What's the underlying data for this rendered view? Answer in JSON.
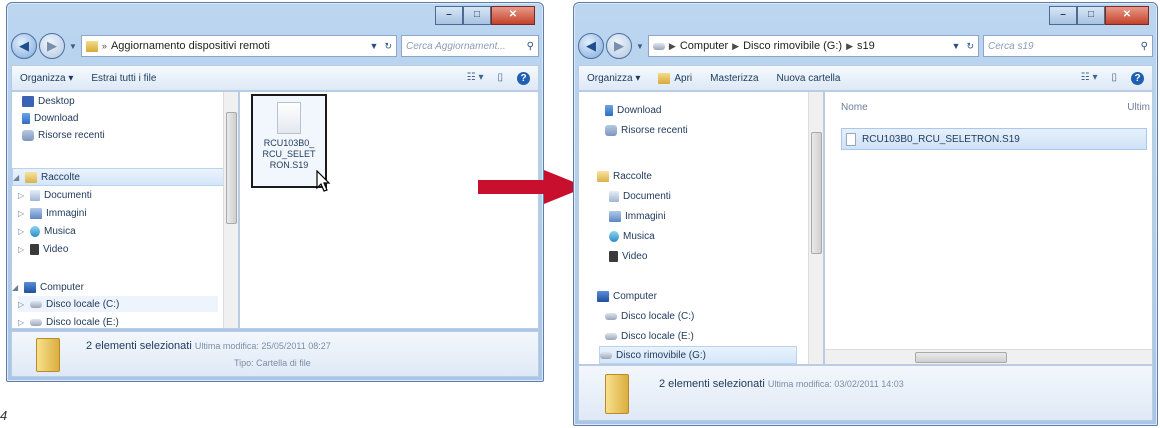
{
  "left_window": {
    "address": {
      "path": [
        "Aggiornamento dispositivi remoti"
      ]
    },
    "search_placeholder": "Cerca Aggiornament...",
    "toolbar": {
      "organize": "Organizza ▾",
      "extract": "Estrai tutti i file"
    },
    "nav_items": [
      {
        "label": "Desktop",
        "icon": "desktop-icon"
      },
      {
        "label": "Download",
        "icon": "download-icon"
      },
      {
        "label": "Risorse recenti",
        "icon": "recent-places-icon"
      },
      {
        "label": "Raccolte",
        "icon": "libraries-icon",
        "selected": true
      },
      {
        "label": "Documenti",
        "icon": "documents-icon"
      },
      {
        "label": "Immagini",
        "icon": "pictures-icon"
      },
      {
        "label": "Musica",
        "icon": "music-icon"
      },
      {
        "label": "Video",
        "icon": "video-icon"
      },
      {
        "label": "Computer",
        "icon": "computer-icon"
      },
      {
        "label": "Disco locale (C:)",
        "icon": "drive-icon"
      },
      {
        "label": "Disco locale (E:)",
        "icon": "drive-icon"
      }
    ],
    "file": {
      "name_lines": [
        "RCU103B0_",
        "RCU_SELET",
        "RON.S19"
      ]
    },
    "status": {
      "text": "2 elementi selezionati",
      "modified_label": "Ultima modifica: 25/05/2011 08:27",
      "type_label": "Tipo: Cartella di file"
    }
  },
  "right_window": {
    "address": {
      "path": [
        "Computer",
        "Disco rimovibile (G:)",
        "s19"
      ]
    },
    "search_placeholder": "Cerca s19",
    "toolbar": {
      "organize": "Organizza ▾",
      "open": "Apri",
      "burn": "Masterizza",
      "new_folder": "Nuova cartella"
    },
    "nav_items": [
      {
        "label": "Download",
        "icon": "download-icon"
      },
      {
        "label": "Risorse recenti",
        "icon": "recent-places-icon"
      },
      {
        "label": "Raccolte",
        "icon": "libraries-icon"
      },
      {
        "label": "Documenti",
        "icon": "documents-icon"
      },
      {
        "label": "Immagini",
        "icon": "pictures-icon"
      },
      {
        "label": "Musica",
        "icon": "music-icon"
      },
      {
        "label": "Video",
        "icon": "video-icon"
      },
      {
        "label": "Computer",
        "icon": "computer-icon"
      },
      {
        "label": "Disco locale (C:)",
        "icon": "drive-icon"
      },
      {
        "label": "Disco locale (E:)",
        "icon": "drive-icon"
      },
      {
        "label": "Disco rimovibile (G:)",
        "icon": "removable-drive-icon",
        "selected": true
      }
    ],
    "columns": {
      "name": "Nome",
      "modified": "Ultim"
    },
    "file": {
      "name": "RCU103B0_RCU_SELETRON.S19"
    },
    "status": {
      "text": "2 elementi selezionati",
      "modified_label": "Ultima modifica: 03/02/2011 14:03"
    }
  },
  "figure_number": "4",
  "colors": {
    "arrow": "#c8102e",
    "selection": "#d4e6f9",
    "frame": "#a9c6e6"
  }
}
